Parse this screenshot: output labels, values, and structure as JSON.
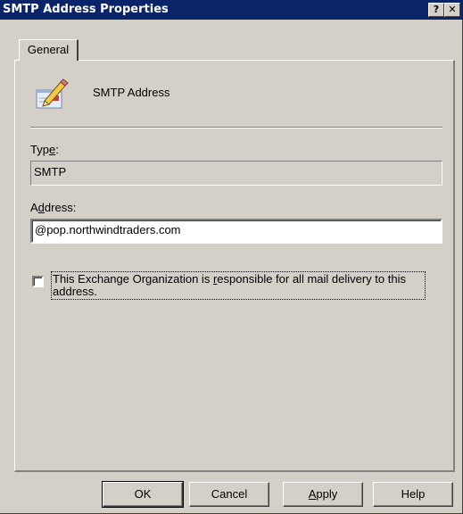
{
  "window": {
    "title": "SMTP Address Properties",
    "help_glyph": "?",
    "close_glyph": "✕"
  },
  "tabs": [
    {
      "label": "General",
      "selected": true
    }
  ],
  "header": {
    "icon": "pencil-edit-icon",
    "label": "SMTP Address"
  },
  "type_field": {
    "label_prefix": "Typ",
    "label_mnemonic": "e",
    "label_suffix": ":",
    "value": "SMTP"
  },
  "address_field": {
    "label_prefix": "A",
    "label_mnemonic": "d",
    "label_suffix": "dress:",
    "value": "@pop.northwindtraders.com"
  },
  "responsibility_checkbox": {
    "checked": false,
    "label_prefix": "This Exchange Organization is ",
    "label_mnemonic": "r",
    "label_suffix": "esponsible for all mail delivery to this address."
  },
  "buttons": {
    "ok": "OK",
    "cancel": "Cancel",
    "apply_mnemonic": "A",
    "apply_rest": "pply",
    "help": "Help"
  },
  "colors": {
    "titlebar": "#0a246a",
    "dialog_face": "#d4d0c8"
  }
}
